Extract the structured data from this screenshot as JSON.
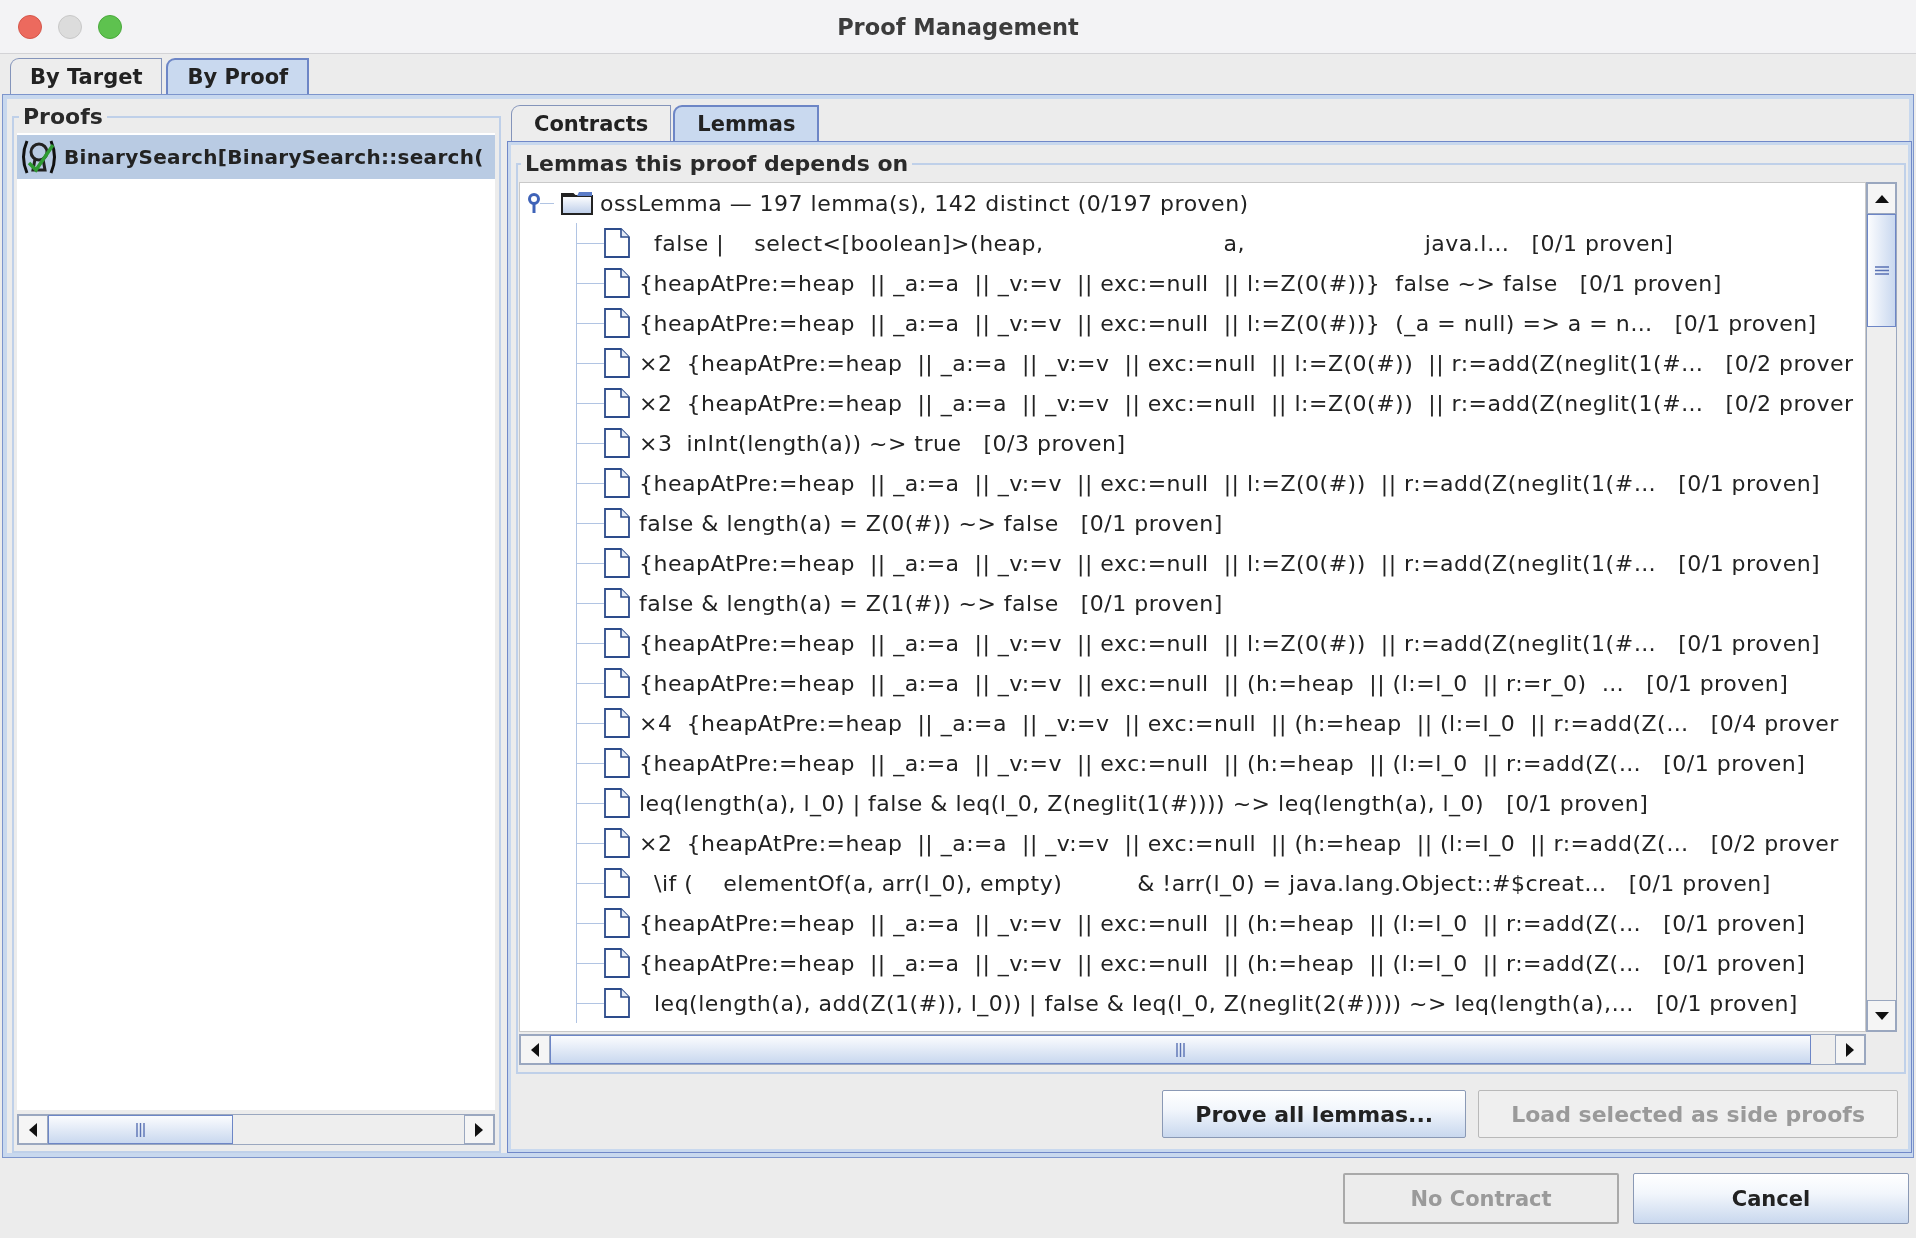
{
  "window": {
    "title": "Proof Management"
  },
  "tabs": [
    {
      "label": "By Target",
      "selected": false
    },
    {
      "label": "By Proof",
      "selected": true
    }
  ],
  "proofs_panel": {
    "title": "Proofs",
    "items": [
      {
        "label": "BinarySearch[BinarySearch::search(",
        "selected": true
      }
    ]
  },
  "detail_tabs": [
    {
      "label": "Contracts",
      "selected": false
    },
    {
      "label": "Lemmas",
      "selected": true
    }
  ],
  "lemmas_panel": {
    "title": "Lemmas this proof depends on",
    "tree": {
      "label": "ossLemma — 197 lemma(s), 142 distinct (0/197 proven)",
      "expanded": true,
      "children": [
        {
          "label": "  false |    select<[boolean]>(heap,                        a,                        java.l…",
          "status": "[0/1 proven]"
        },
        {
          "label": "{heapAtPre:=heap  || _a:=a  || _v:=v  || exc:=null  || l:=Z(0(#))}  false ~> false",
          "status": "[0/1 proven]"
        },
        {
          "label": "{heapAtPre:=heap  || _a:=a  || _v:=v  || exc:=null  || l:=Z(0(#))}  (_a = null) => a = n…",
          "status": "[0/1 proven]"
        },
        {
          "count": "×2",
          "label": "{heapAtPre:=heap  || _a:=a  || _v:=v  || exc:=null  || l:=Z(0(#))  || r:=add(Z(neglit(1(#…",
          "status": "[0/2 prover"
        },
        {
          "count": "×2",
          "label": "{heapAtPre:=heap  || _a:=a  || _v:=v  || exc:=null  || l:=Z(0(#))  || r:=add(Z(neglit(1(#…",
          "status": "[0/2 prover"
        },
        {
          "count": "×3",
          "label": "inInt(length(a)) ~> true",
          "status": "[0/3 proven]"
        },
        {
          "label": "{heapAtPre:=heap  || _a:=a  || _v:=v  || exc:=null  || l:=Z(0(#))  || r:=add(Z(neglit(1(#…",
          "status": "[0/1 proven]"
        },
        {
          "label": "false & length(a) = Z(0(#)) ~> false",
          "status": "[0/1 proven]"
        },
        {
          "label": "{heapAtPre:=heap  || _a:=a  || _v:=v  || exc:=null  || l:=Z(0(#))  || r:=add(Z(neglit(1(#…",
          "status": "[0/1 proven]"
        },
        {
          "label": "false & length(a) = Z(1(#)) ~> false",
          "status": "[0/1 proven]"
        },
        {
          "label": "{heapAtPre:=heap  || _a:=a  || _v:=v  || exc:=null  || l:=Z(0(#))  || r:=add(Z(neglit(1(#…",
          "status": "[0/1 proven]"
        },
        {
          "label": "{heapAtPre:=heap  || _a:=a  || _v:=v  || exc:=null  || (h:=heap  || (l:=l_0  || r:=r_0)  …",
          "status": "[0/1 proven]"
        },
        {
          "count": "×4",
          "label": "{heapAtPre:=heap  || _a:=a  || _v:=v  || exc:=null  || (h:=heap  || (l:=l_0  || r:=add(Z(…",
          "status": "[0/4 prover"
        },
        {
          "label": "{heapAtPre:=heap  || _a:=a  || _v:=v  || exc:=null  || (h:=heap  || (l:=l_0  || r:=add(Z(…",
          "status": "[0/1 proven]"
        },
        {
          "label": "leq(length(a), l_0) | false & leq(l_0, Z(neglit(1(#)))) ~> leq(length(a), l_0)",
          "status": "[0/1 proven]"
        },
        {
          "count": "×2",
          "label": "{heapAtPre:=heap  || _a:=a  || _v:=v  || exc:=null  || (h:=heap  || (l:=l_0  || r:=add(Z(…",
          "status": "[0/2 prover"
        },
        {
          "label": "  \\if (    elementOf(a, arr(l_0), empty)          & !arr(l_0) = java.lang.Object::#$creat…",
          "status": "[0/1 proven]"
        },
        {
          "label": "{heapAtPre:=heap  || _a:=a  || _v:=v  || exc:=null  || (h:=heap  || (l:=l_0  || r:=add(Z(…",
          "status": "[0/1 proven]"
        },
        {
          "label": "{heapAtPre:=heap  || _a:=a  || _v:=v  || exc:=null  || (h:=heap  || (l:=l_0  || r:=add(Z(…",
          "status": "[0/1 proven]"
        },
        {
          "label": "  leq(length(a), add(Z(1(#)), l_0)) | false & leq(l_0, Z(neglit(2(#)))) ~> leq(length(a),…",
          "status": "[0/1 proven]"
        }
      ]
    }
  },
  "lemma_buttons": [
    {
      "label": "Prove all lemmas...",
      "disabled": false
    },
    {
      "label": "Load selected as side proofs",
      "disabled": true
    }
  ],
  "dialog_buttons": [
    {
      "label": "No Contract",
      "disabled": true
    },
    {
      "label": "Cancel",
      "disabled": false
    }
  ]
}
